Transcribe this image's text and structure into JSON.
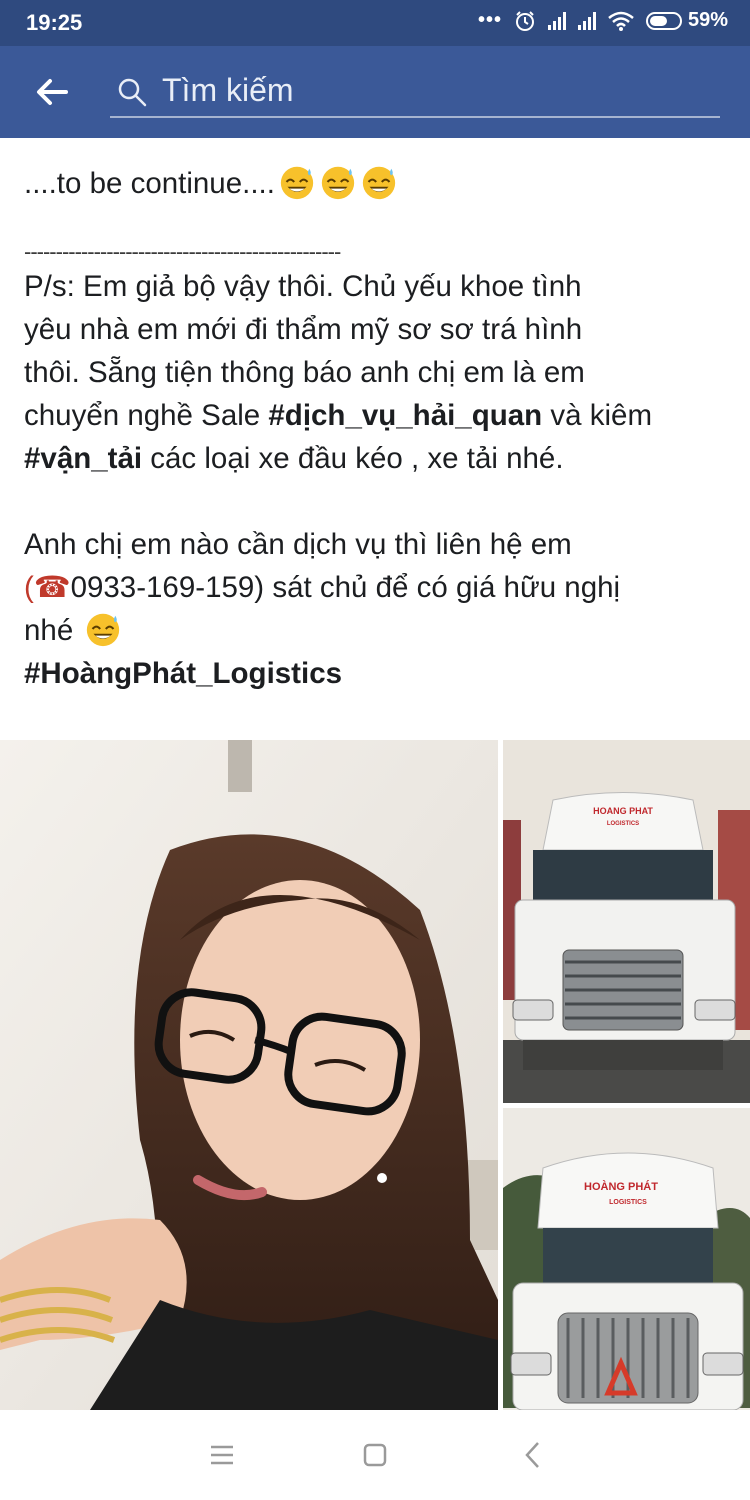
{
  "status_bar": {
    "time": "19:25",
    "battery": "59%",
    "battery_level": 0.59
  },
  "search": {
    "placeholder": "Tìm kiếm"
  },
  "post": {
    "line_continue": "....to be continue....",
    "separator": "--------------------------------------------------",
    "ps_line1": "P/s: Em giả bộ vậy thôi. Chủ yếu khoe tình",
    "ps_line2": "yêu nhà em mới đi thẩm mỹ sơ sơ trá hình",
    "ps_line3": "thôi. Sẵng tiện thông báo anh chị em là em",
    "ps_line4_pre": "chuyển nghề Sale ",
    "hashtag_service": "#dịch_vụ_hải_quan",
    "ps_line4_post": " và kiêm",
    "hashtag_transport": "#vận_tải",
    "ps_line5_post": " các loại xe đầu kéo , xe tải nhé.",
    "contact_line1": "Anh chị em nào cần dịch vụ thì liên hệ em",
    "contact_phone_open": "(☎",
    "contact_phone": "0933-169-159",
    "contact_line2_post": ") sát chủ để có giá hữu nghị",
    "contact_line3": "nhé ",
    "hashtag_company": "#HoàngPhát_Logistics"
  },
  "photos": {
    "truck1_logo_1": "HOANG PHAT",
    "truck1_logo_2": "LOGISTICS",
    "truck2_logo_1": "HOÀNG PHÁT",
    "truck2_logo_2": "LOGISTICS"
  },
  "colors": {
    "status_bar": "#2f4a7f",
    "top_bar": "#3b5998",
    "text": "#1c1e21"
  }
}
